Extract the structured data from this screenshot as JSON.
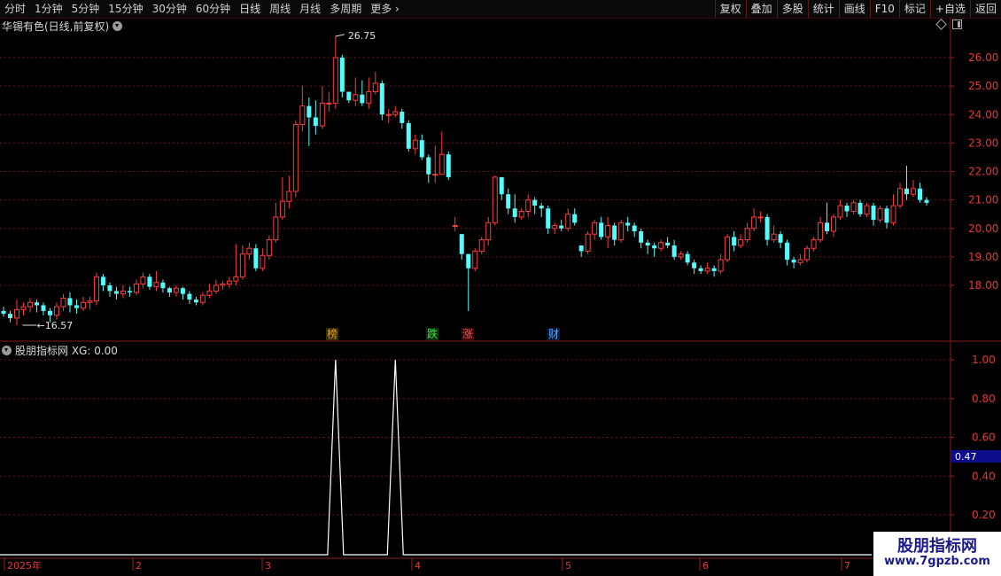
{
  "toolbar": {
    "period_tabs": [
      "分时",
      "1分钟",
      "5分钟",
      "15分钟",
      "30分钟",
      "60分钟",
      "日线",
      "周线",
      "月线",
      "多周期",
      "更多"
    ],
    "right_tools": [
      "复权",
      "叠加",
      "多股",
      "统计",
      "画线",
      "F10",
      "标记",
      "+自选",
      "返回"
    ]
  },
  "main": {
    "title": "华锡有色(日线,前复权)"
  },
  "indicator": {
    "title": "股朋指标网 XG: 0.00",
    "current_value": "0.47"
  },
  "watermark": {
    "line1": "股朋指标网",
    "line2": "www.7gpzb.com"
  },
  "chart_data": [
    {
      "type": "candlestick",
      "title": "华锡有色(日线,前复权)",
      "y_ticks": [
        18.0,
        19.0,
        20.0,
        21.0,
        22.0,
        23.0,
        24.0,
        25.0,
        26.0
      ],
      "ylim": [
        16.2,
        26.9
      ],
      "x_ticks": [
        "2025年",
        "2",
        "3",
        "4",
        "5",
        "6",
        "7"
      ],
      "annotations": {
        "high": "26.75",
        "low": "16.57"
      },
      "markers": [
        "榜",
        "跌",
        "涨",
        "财"
      ],
      "colors": {
        "up": "#ff3c3c",
        "down": "#54fcfc",
        "grid": "#6e1414",
        "axis": "#8c1c1c"
      },
      "candles": [
        [
          17.1,
          17.0,
          17.25,
          16.9
        ],
        [
          17.0,
          16.85,
          17.1,
          16.7
        ],
        [
          16.85,
          17.15,
          17.5,
          16.6
        ],
        [
          17.15,
          17.25,
          17.4,
          16.95
        ],
        [
          17.25,
          17.4,
          17.55,
          17.05
        ],
        [
          17.4,
          17.3,
          17.5,
          17.05
        ],
        [
          17.3,
          17.1,
          17.4,
          16.95
        ],
        [
          17.1,
          16.95,
          17.2,
          16.7
        ],
        [
          16.95,
          17.25,
          17.4,
          16.8
        ],
        [
          17.25,
          17.55,
          17.7,
          17.1
        ],
        [
          17.55,
          17.3,
          17.75,
          17.05
        ],
        [
          17.3,
          17.2,
          17.5,
          17.0
        ],
        [
          17.2,
          17.4,
          17.6,
          17.1
        ],
        [
          17.4,
          17.45,
          17.6,
          17.15
        ],
        [
          17.45,
          18.3,
          18.45,
          17.3
        ],
        [
          18.3,
          18.0,
          18.4,
          17.8
        ],
        [
          18.0,
          17.8,
          18.1,
          17.6
        ],
        [
          17.8,
          17.7,
          17.95,
          17.5
        ],
        [
          17.7,
          17.8,
          18.0,
          17.55
        ],
        [
          17.8,
          17.75,
          17.95,
          17.6
        ],
        [
          17.75,
          18.05,
          18.2,
          17.65
        ],
        [
          18.05,
          18.3,
          18.45,
          17.9
        ],
        [
          18.3,
          17.95,
          18.4,
          17.85
        ],
        [
          17.95,
          18.1,
          18.5,
          17.8
        ],
        [
          18.1,
          17.9,
          18.2,
          17.75
        ],
        [
          17.9,
          17.75,
          17.95,
          17.6
        ],
        [
          17.75,
          17.9,
          18.0,
          17.6
        ],
        [
          17.9,
          17.7,
          17.95,
          17.5
        ],
        [
          17.7,
          17.5,
          17.8,
          17.35
        ],
        [
          17.5,
          17.4,
          17.6,
          17.3
        ],
        [
          17.4,
          17.65,
          17.75,
          17.3
        ],
        [
          17.65,
          17.8,
          18.05,
          17.55
        ],
        [
          17.8,
          18.0,
          18.2,
          17.7
        ],
        [
          18.0,
          18.05,
          18.15,
          17.85
        ],
        [
          18.05,
          18.15,
          18.3,
          17.9
        ],
        [
          18.15,
          18.3,
          19.45,
          18.0
        ],
        [
          18.3,
          19.1,
          19.4,
          18.2
        ],
        [
          19.1,
          19.3,
          19.5,
          18.9
        ],
        [
          19.3,
          18.6,
          19.45,
          18.5
        ],
        [
          18.6,
          19.05,
          19.3,
          18.5
        ],
        [
          19.05,
          19.6,
          19.75,
          18.9
        ],
        [
          19.6,
          20.4,
          20.9,
          19.5
        ],
        [
          20.4,
          20.95,
          21.8,
          20.3
        ],
        [
          20.95,
          21.3,
          21.85,
          20.7
        ],
        [
          21.3,
          23.65,
          23.8,
          21.1
        ],
        [
          23.65,
          24.3,
          25.0,
          23.4
        ],
        [
          24.3,
          23.9,
          24.6,
          22.9
        ],
        [
          23.9,
          23.6,
          24.5,
          23.3
        ],
        [
          23.6,
          24.4,
          25.0,
          23.5
        ],
        [
          24.4,
          24.4,
          24.8,
          24.1
        ],
        [
          24.4,
          26.0,
          26.75,
          24.2
        ],
        [
          26.0,
          24.8,
          26.1,
          24.6
        ],
        [
          24.8,
          24.5,
          24.8,
          24.4
        ],
        [
          24.5,
          24.7,
          25.3,
          24.3
        ],
        [
          24.7,
          24.4,
          25.2,
          24.3
        ],
        [
          24.4,
          24.8,
          25.3,
          24.2
        ],
        [
          24.8,
          25.1,
          25.5,
          24.7
        ],
        [
          25.1,
          24.0,
          25.2,
          23.8
        ],
        [
          24.0,
          24.0,
          24.2,
          23.7
        ],
        [
          24.0,
          24.1,
          24.3,
          23.9
        ],
        [
          24.1,
          23.7,
          24.2,
          23.5
        ],
        [
          23.7,
          22.8,
          23.8,
          22.7
        ],
        [
          22.8,
          23.1,
          23.3,
          22.6
        ],
        [
          23.1,
          22.5,
          23.3,
          22.4
        ],
        [
          22.5,
          21.9,
          22.6,
          21.6
        ],
        [
          21.9,
          21.9,
          22.9,
          21.6
        ],
        [
          21.9,
          22.6,
          23.4,
          22.5
        ],
        [
          22.6,
          21.8,
          22.7,
          21.7
        ],
        [
          20.1,
          20.1,
          20.4,
          19.9
        ],
        [
          19.8,
          19.1,
          19.8,
          18.9
        ],
        [
          19.1,
          18.6,
          19.1,
          17.1
        ],
        [
          18.6,
          19.2,
          19.3,
          18.5
        ],
        [
          19.2,
          19.6,
          19.7,
          19.1
        ],
        [
          19.6,
          20.2,
          20.4,
          19.4
        ],
        [
          20.2,
          21.8,
          21.85,
          20.1
        ],
        [
          21.8,
          21.2,
          21.8,
          21.0
        ],
        [
          21.2,
          20.7,
          21.4,
          20.5
        ],
        [
          20.7,
          20.4,
          21.2,
          20.2
        ],
        [
          20.4,
          20.6,
          20.7,
          20.3
        ],
        [
          20.6,
          21.0,
          21.2,
          20.4
        ],
        [
          21.0,
          20.8,
          21.1,
          20.5
        ],
        [
          20.8,
          20.7,
          20.9,
          20.4
        ],
        [
          20.7,
          20.0,
          20.8,
          19.8
        ],
        [
          20.0,
          20.1,
          20.2,
          19.8
        ],
        [
          20.1,
          20.0,
          20.3,
          19.9
        ],
        [
          20.0,
          20.5,
          20.7,
          19.9
        ],
        [
          20.5,
          20.2,
          20.7,
          20.1
        ],
        [
          19.4,
          19.2,
          19.4,
          19.0
        ],
        [
          19.2,
          19.8,
          19.9,
          19.1
        ],
        [
          19.8,
          20.2,
          20.3,
          19.6
        ],
        [
          20.2,
          19.7,
          20.4,
          19.6
        ],
        [
          19.7,
          20.1,
          20.4,
          19.3
        ],
        [
          20.1,
          19.6,
          20.2,
          19.4
        ],
        [
          19.6,
          20.2,
          20.3,
          19.5
        ],
        [
          20.2,
          20.1,
          20.4,
          19.9
        ],
        [
          20.1,
          19.9,
          20.2,
          19.7
        ],
        [
          19.9,
          19.5,
          20.0,
          19.3
        ],
        [
          19.5,
          19.4,
          19.6,
          19.1
        ],
        [
          19.4,
          19.3,
          19.5,
          19.0
        ],
        [
          19.3,
          19.5,
          19.6,
          19.2
        ],
        [
          19.5,
          19.4,
          19.7,
          19.3
        ],
        [
          19.4,
          19.0,
          19.6,
          18.9
        ],
        [
          19.0,
          19.1,
          19.2,
          18.9
        ],
        [
          19.1,
          18.8,
          19.2,
          18.7
        ],
        [
          18.8,
          18.6,
          18.9,
          18.4
        ],
        [
          18.6,
          18.5,
          18.7,
          18.4
        ],
        [
          18.5,
          18.6,
          18.8,
          18.4
        ],
        [
          18.6,
          18.5,
          18.7,
          18.3
        ],
        [
          18.5,
          18.9,
          19.1,
          18.4
        ],
        [
          18.9,
          19.7,
          19.8,
          18.8
        ],
        [
          19.7,
          19.4,
          19.9,
          19.2
        ],
        [
          19.4,
          19.6,
          19.8,
          19.3
        ],
        [
          19.6,
          20.0,
          20.2,
          19.5
        ],
        [
          20.0,
          20.4,
          20.7,
          19.9
        ],
        [
          20.4,
          20.4,
          20.6,
          20.2
        ],
        [
          20.4,
          19.6,
          20.5,
          19.4
        ],
        [
          19.6,
          19.8,
          20.1,
          19.5
        ],
        [
          19.8,
          19.5,
          19.9,
          19.3
        ],
        [
          19.5,
          18.9,
          19.6,
          18.7
        ],
        [
          18.9,
          18.8,
          19.0,
          18.6
        ],
        [
          18.8,
          18.9,
          19.1,
          18.7
        ],
        [
          18.9,
          19.3,
          19.4,
          18.8
        ],
        [
          19.3,
          19.6,
          19.7,
          19.2
        ],
        [
          19.6,
          20.2,
          20.4,
          19.5
        ],
        [
          20.2,
          19.9,
          20.9,
          19.8
        ],
        [
          19.9,
          20.4,
          20.5,
          19.7
        ],
        [
          20.4,
          20.8,
          21.0,
          20.3
        ],
        [
          20.8,
          20.6,
          20.9,
          20.4
        ],
        [
          20.6,
          20.9,
          21.0,
          20.5
        ],
        [
          20.9,
          20.5,
          21.0,
          20.4
        ],
        [
          20.5,
          20.8,
          20.9,
          20.4
        ],
        [
          20.8,
          20.3,
          20.9,
          20.1
        ],
        [
          20.3,
          20.7,
          20.8,
          20.2
        ],
        [
          20.7,
          20.2,
          20.8,
          20.0
        ],
        [
          20.2,
          20.8,
          21.2,
          20.1
        ],
        [
          20.8,
          21.4,
          21.6,
          20.7
        ],
        [
          21.4,
          21.2,
          22.2,
          21.0
        ],
        [
          21.2,
          21.4,
          21.7,
          21.1
        ],
        [
          21.4,
          21.0,
          21.6,
          20.9
        ],
        [
          21.0,
          20.9,
          21.1,
          20.8
        ]
      ]
    },
    {
      "type": "line",
      "title": "股朋指标网 XG: 0.00",
      "y_ticks": [
        0.2,
        0.4,
        0.6,
        0.8,
        1.0
      ],
      "ylim": [
        -0.05,
        1.05
      ],
      "series": [
        {
          "name": "XG",
          "spikes": [
            50,
            59
          ],
          "values_baseline": 0,
          "spike_value": 1
        }
      ],
      "current": "0.47"
    }
  ]
}
